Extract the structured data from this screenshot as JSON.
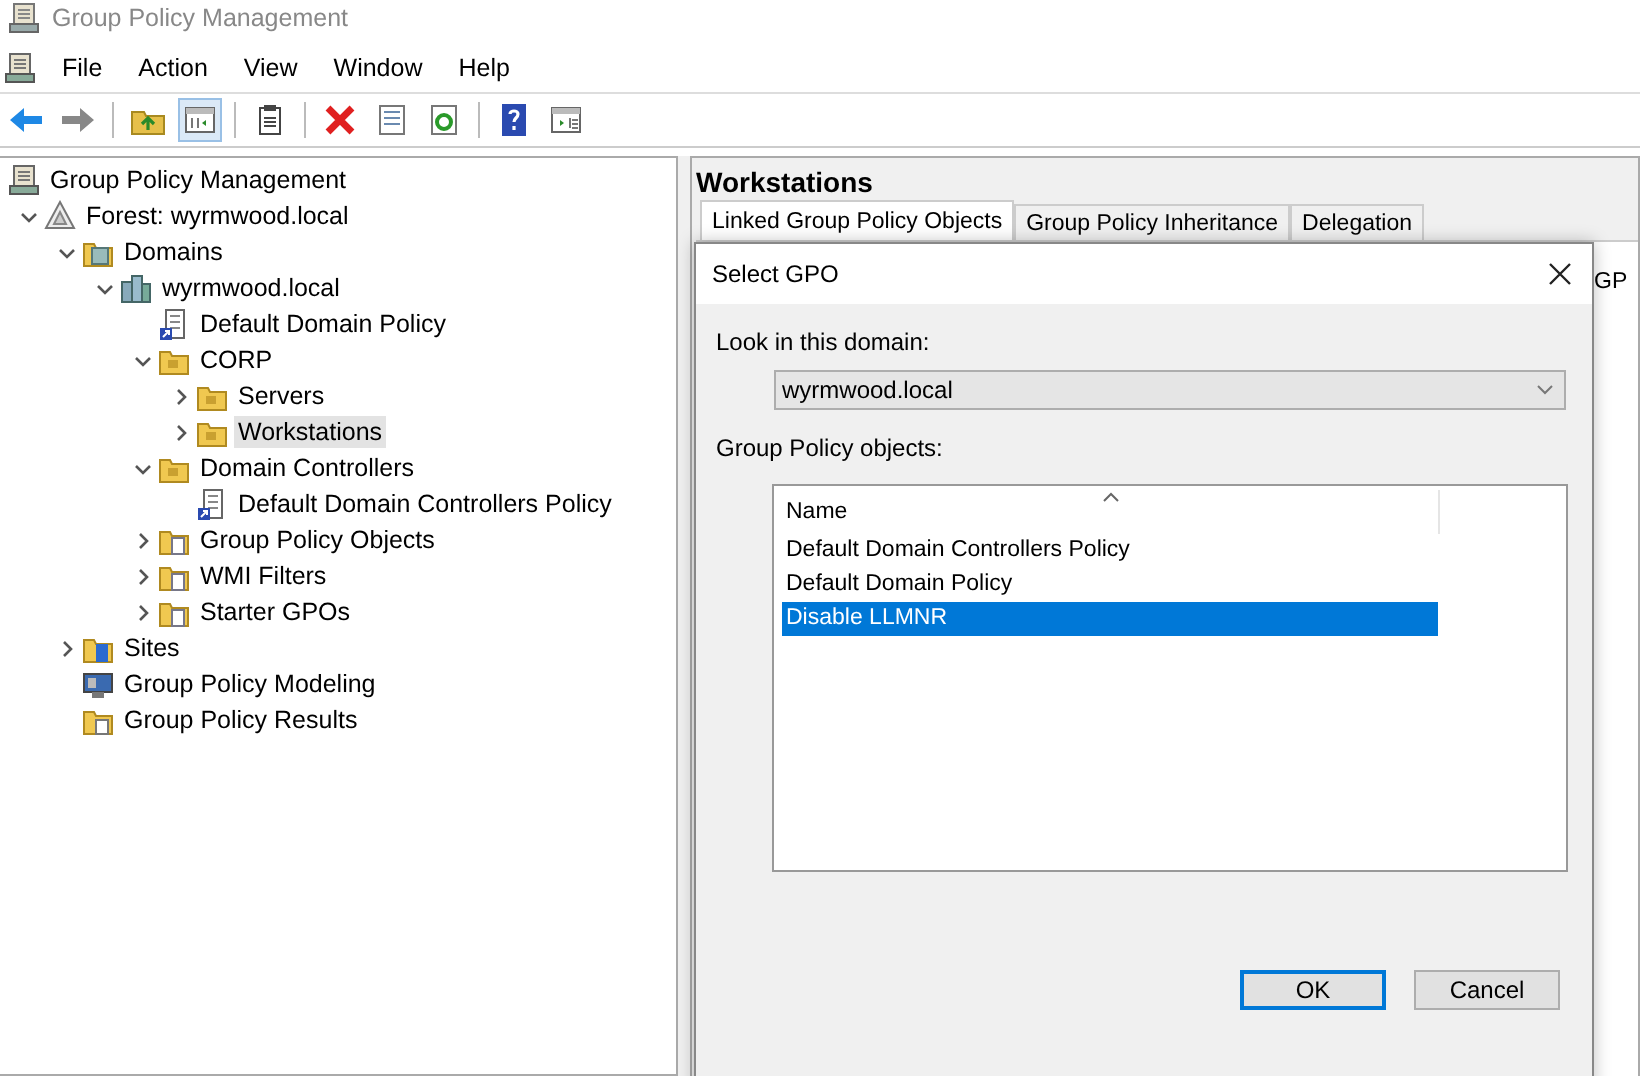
{
  "window": {
    "title": "Group Policy Management"
  },
  "menu": [
    "File",
    "Action",
    "View",
    "Window",
    "Help"
  ],
  "toolbar": [
    {
      "kind": "back",
      "pressed": false
    },
    {
      "kind": "forward",
      "pressed": false
    },
    {
      "kind": "up",
      "pressed": false
    },
    {
      "kind": "tree",
      "pressed": true
    },
    {
      "kind": "clipboard",
      "pressed": false
    },
    {
      "kind": "delete",
      "pressed": false
    },
    {
      "kind": "properties",
      "pressed": false
    },
    {
      "kind": "refresh",
      "pressed": false
    },
    {
      "kind": "help",
      "pressed": false
    },
    {
      "kind": "panel",
      "pressed": false
    }
  ],
  "tree": [
    {
      "label": "Group Policy Management",
      "kind": "console",
      "selected": false,
      "children": [
        {
          "label": "Forest: wyrmwood.local",
          "kind": "forest",
          "expanded": true,
          "selected": false,
          "children": [
            {
              "label": "Domains",
              "kind": "domains",
              "expanded": true,
              "selected": false,
              "children": [
                {
                  "label": "wyrmwood.local",
                  "kind": "domain",
                  "expanded": true,
                  "selected": false,
                  "children": [
                    {
                      "label": "Default Domain Policy",
                      "kind": "gpo",
                      "selected": false
                    },
                    {
                      "label": "CORP",
                      "kind": "ou",
                      "expanded": true,
                      "selected": false,
                      "children": [
                        {
                          "label": "Servers",
                          "kind": "ou",
                          "expanded": false,
                          "selected": false
                        },
                        {
                          "label": "Workstations",
                          "kind": "ou",
                          "expanded": false,
                          "selected": true
                        }
                      ]
                    },
                    {
                      "label": "Domain Controllers",
                      "kind": "ou",
                      "expanded": true,
                      "selected": false,
                      "children": [
                        {
                          "label": "Default Domain Controllers Policy",
                          "kind": "gpo",
                          "selected": false
                        }
                      ]
                    },
                    {
                      "label": "Group Policy Objects",
                      "kind": "folder",
                      "expanded": false,
                      "selected": false
                    },
                    {
                      "label": "WMI Filters",
                      "kind": "folder",
                      "expanded": false,
                      "selected": false
                    },
                    {
                      "label": "Starter GPOs",
                      "kind": "folder",
                      "expanded": false,
                      "selected": false
                    }
                  ]
                }
              ]
            },
            {
              "label": "Sites",
              "kind": "sites",
              "expanded": false,
              "selected": false
            },
            {
              "label": "Group Policy Modeling",
              "kind": "modeling",
              "selected": false
            },
            {
              "label": "Group Policy Results",
              "kind": "results",
              "selected": false
            }
          ]
        }
      ]
    }
  ],
  "details": {
    "title": "Workstations",
    "tabs": [
      {
        "label": "Linked Group Policy Objects",
        "selected": true
      },
      {
        "label": "Group Policy Inheritance",
        "selected": false
      },
      {
        "label": "Delegation",
        "selected": false
      }
    ],
    "partial_column_header": "GP"
  },
  "dialog": {
    "title": "Select GPO",
    "domain_label": "Look in this domain:",
    "domain_value": "wyrmwood.local",
    "objects_label": "Group Policy objects:",
    "list": {
      "column": "Name",
      "rows": [
        {
          "name": "Default Domain Controllers Policy",
          "selected": false
        },
        {
          "name": "Default Domain Policy",
          "selected": false
        },
        {
          "name": "Disable LLMNR",
          "selected": true
        }
      ]
    },
    "buttons": [
      {
        "label": "OK",
        "default": true
      },
      {
        "label": "Cancel",
        "default": false
      }
    ]
  }
}
